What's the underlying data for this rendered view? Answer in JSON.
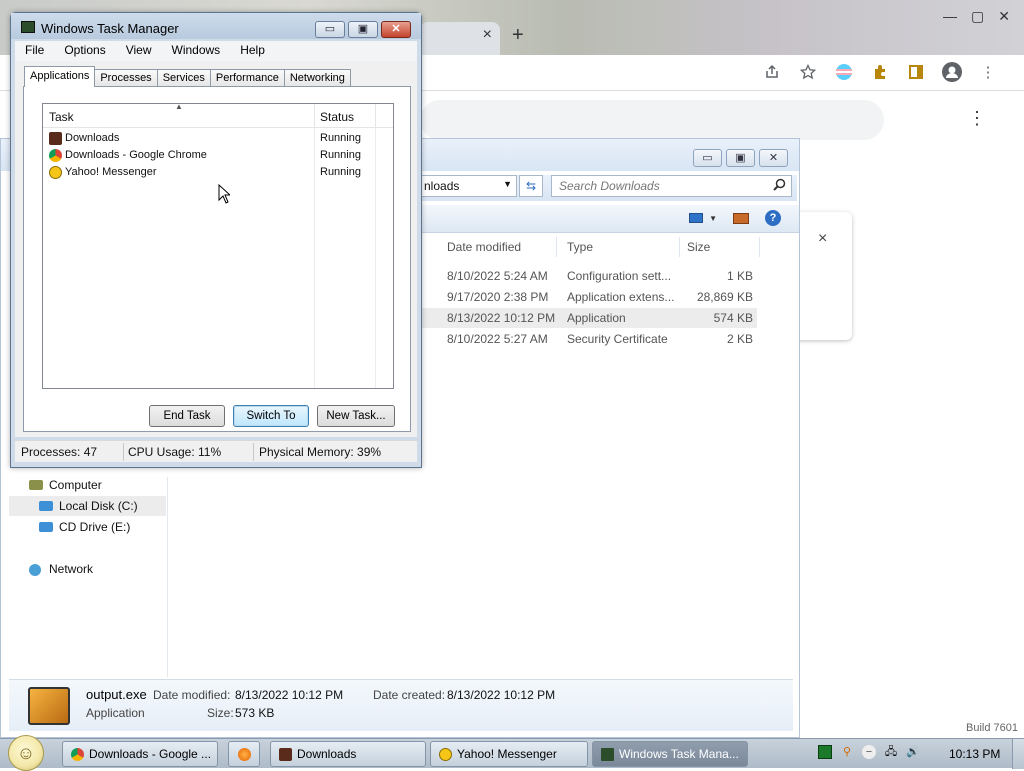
{
  "chrome": {
    "tab_close": "×",
    "new_tab": "+",
    "win_min": "—",
    "win_max": "▢",
    "win_close": "✕",
    "kebab": "⋮",
    "popup_close": "×",
    "build_text": "Build 7601"
  },
  "explorer": {
    "win_min": "▭",
    "win_max": "▣",
    "win_close": "✕",
    "address_partial": "nloads",
    "search_placeholder": "Search Downloads",
    "columns": [
      "Date modified",
      "Type",
      "Size"
    ],
    "files": [
      {
        "date": "8/10/2022 5:24 AM",
        "type": "Configuration sett...",
        "size": "1 KB",
        "selected": false
      },
      {
        "date": "9/17/2020 2:38 PM",
        "type": "Application extens...",
        "size": "28,869 KB",
        "selected": false
      },
      {
        "date": "8/13/2022 10:12 PM",
        "type": "Application",
        "size": "574 KB",
        "selected": true
      },
      {
        "date": "8/10/2022 5:27 AM",
        "type": "Security Certificate",
        "size": "2 KB",
        "selected": false
      }
    ],
    "nav": {
      "computer": "Computer",
      "local_disk": "Local Disk (C:)",
      "cd_drive": "CD Drive (E:)",
      "network": "Network"
    },
    "details": {
      "filename": "output.exe",
      "kind": "Application",
      "date_modified_label": "Date modified:",
      "date_modified": "8/13/2022 10:12 PM",
      "date_created_label": "Date created:",
      "date_created": "8/13/2022 10:12 PM",
      "size_label": "Size:",
      "size": "573 KB"
    }
  },
  "taskmgr": {
    "title": "Windows Task Manager",
    "menu": [
      "File",
      "Options",
      "View",
      "Windows",
      "Help"
    ],
    "tabs": [
      "Applications",
      "Processes",
      "Services",
      "Performance",
      "Networking"
    ],
    "active_tab": "Applications",
    "columns": {
      "task": "Task",
      "status": "Status"
    },
    "tasks": [
      {
        "name": "Downloads",
        "status": "Running",
        "icon": "explorer-icon"
      },
      {
        "name": "Downloads - Google Chrome",
        "status": "Running",
        "icon": "chrome-icon"
      },
      {
        "name": "Yahoo! Messenger",
        "status": "Running",
        "icon": "yahoo-messenger-icon"
      }
    ],
    "buttons": {
      "end_task": "End Task",
      "switch_to": "Switch To",
      "new_task": "New Task..."
    },
    "status": {
      "processes": "Processes: 47",
      "cpu": "CPU Usage: 11%",
      "memory": "Physical Memory: 39%"
    }
  },
  "taskbar": {
    "items": [
      {
        "label": "Downloads - Google ...",
        "icon": "chrome-icon"
      },
      {
        "label": "Downloads",
        "icon": "explorer-icon"
      },
      {
        "label": "Yahoo! Messenger",
        "icon": "yahoo-messenger-icon"
      },
      {
        "label": "Windows Task Mana...",
        "icon": "task-manager-icon"
      }
    ],
    "clock": "10:13 PM"
  }
}
